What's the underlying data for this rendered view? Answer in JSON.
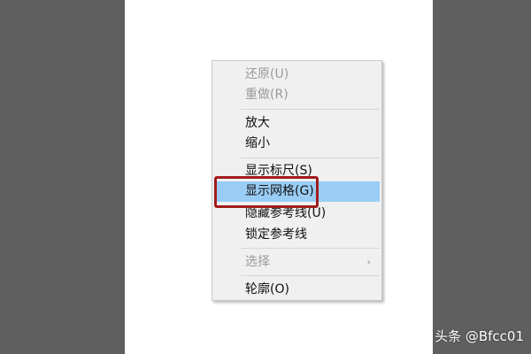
{
  "menu": {
    "undo": "还原(U)",
    "redo": "重做(R)",
    "zoom_in": "放大",
    "zoom_out": "缩小",
    "show_rulers": "显示标尺(S)",
    "show_grid": "显示网格(G)",
    "hide_guides": "隐藏参考线(U)",
    "lock_guides": "锁定参考线",
    "select": "选择",
    "submenu_arrow": "›",
    "outline": "轮廓(O)"
  },
  "watermark": "头条 @Bfcc01",
  "colors": {
    "highlight": "#99cdf5",
    "annotation": "#a31c1c",
    "disabled_text": "#9a9a9a"
  }
}
